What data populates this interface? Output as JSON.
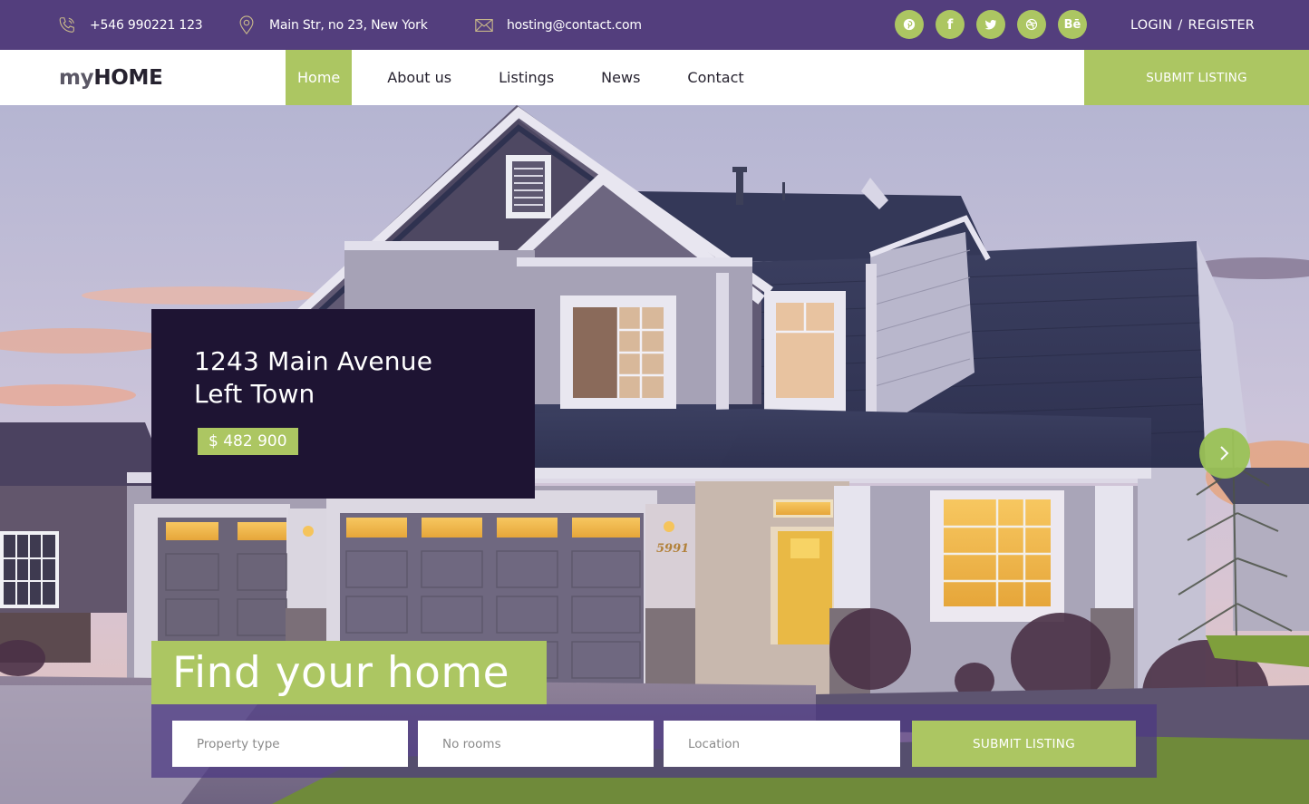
{
  "topbar": {
    "phone": "+546 990221 123",
    "address": "Main Str, no 23, New York",
    "email": "hosting@contact.com",
    "phone_icon": "phone-icon",
    "address_icon": "map-pin-icon",
    "email_icon": "envelope-icon",
    "socials": [
      {
        "name": "pinterest",
        "icon": "pinterest-icon"
      },
      {
        "name": "facebook",
        "icon": "facebook-icon",
        "glyph": "f"
      },
      {
        "name": "twitter",
        "icon": "twitter-icon"
      },
      {
        "name": "dribbble",
        "icon": "dribbble-icon"
      },
      {
        "name": "behance",
        "icon": "behance-icon",
        "glyph": "Bē"
      }
    ],
    "login": "LOGIN",
    "separator": "/",
    "register": "REGISTER"
  },
  "nav": {
    "logo_prefix": "my",
    "logo_main": "HOME",
    "items": [
      {
        "label": "Home",
        "active": true
      },
      {
        "label": "About us",
        "active": false
      },
      {
        "label": "Listings",
        "active": false
      },
      {
        "label": "News",
        "active": false
      },
      {
        "label": "Contact",
        "active": false
      }
    ],
    "submit_label": "SUBMIT LISTING"
  },
  "hero": {
    "property": {
      "title_line1": "1243 Main Avenue",
      "title_line2": "Left Town",
      "price": "$ 482 900"
    },
    "next_icon": "chevron-right-icon",
    "house_number": "5991",
    "headline": "Find your home",
    "search": {
      "property_type_placeholder": "Property type",
      "rooms_placeholder": "No rooms",
      "location_placeholder": "Location",
      "submit_label": "SUBMIT LISTING"
    }
  },
  "colors": {
    "topbar_purple": "#533e7d",
    "accent_green": "#acc662",
    "card_dark": "#1e1433",
    "text_dark": "#26222f"
  }
}
